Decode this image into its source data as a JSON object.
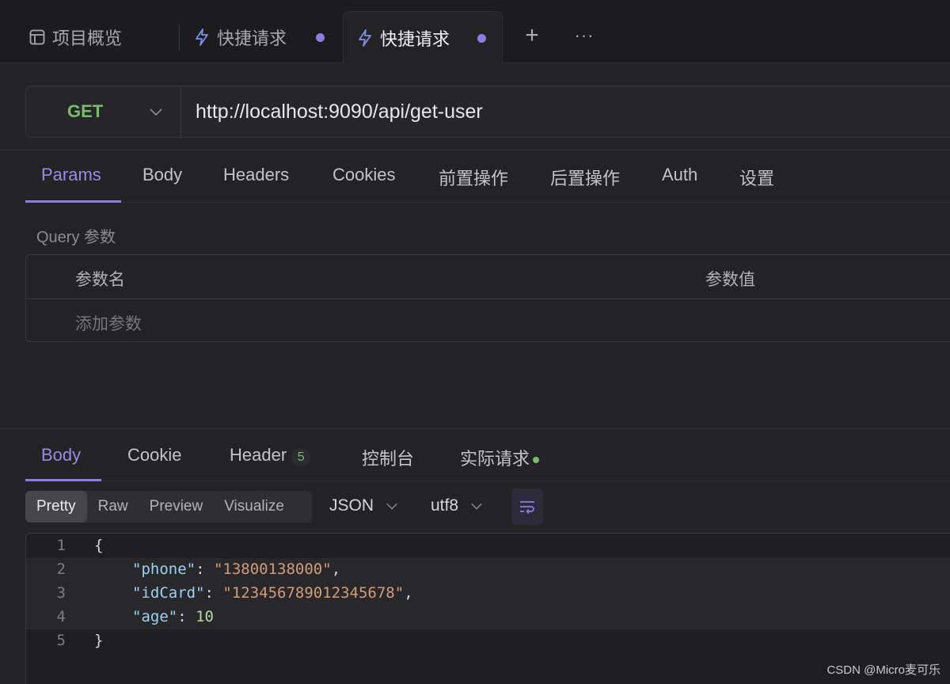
{
  "tabs": {
    "overview_label": "项目概览",
    "tab1_label": "快捷请求",
    "tab2_label": "快捷请求",
    "add_symbol": "+",
    "more_symbol": "···"
  },
  "request": {
    "method": "GET",
    "url": "http://localhost:9090/api/get-user"
  },
  "request_tabs": [
    "Params",
    "Body",
    "Headers",
    "Cookies",
    "前置操作",
    "后置操作",
    "Auth",
    "设置"
  ],
  "params": {
    "section_label": "Query 参数",
    "col_name": "参数名",
    "col_value": "参数值",
    "add_placeholder": "添加参数"
  },
  "response_tabs": {
    "body": "Body",
    "cookie": "Cookie",
    "header": "Header",
    "header_count": "5",
    "console": "控制台",
    "actual": "实际请求"
  },
  "view_modes": [
    "Pretty",
    "Raw",
    "Preview",
    "Visualize"
  ],
  "format_select": "JSON",
  "encoding_select": "utf8",
  "code": {
    "line_numbers": [
      "1",
      "2",
      "3",
      "4",
      "5"
    ],
    "open_brace": "{",
    "close_brace": "}",
    "fields": [
      {
        "key": "\"phone\"",
        "value": "\"13800138000\"",
        "trail": ","
      },
      {
        "key": "\"idCard\"",
        "value": "\"123456789012345678\"",
        "trail": ","
      },
      {
        "key": "\"age\"",
        "value": "10",
        "trail": ""
      }
    ]
  },
  "watermark": "CSDN @Micro麦可乐",
  "colors": {
    "accent": "#8f7ce0",
    "method_get": "#79bd6c",
    "background": "#232325"
  }
}
